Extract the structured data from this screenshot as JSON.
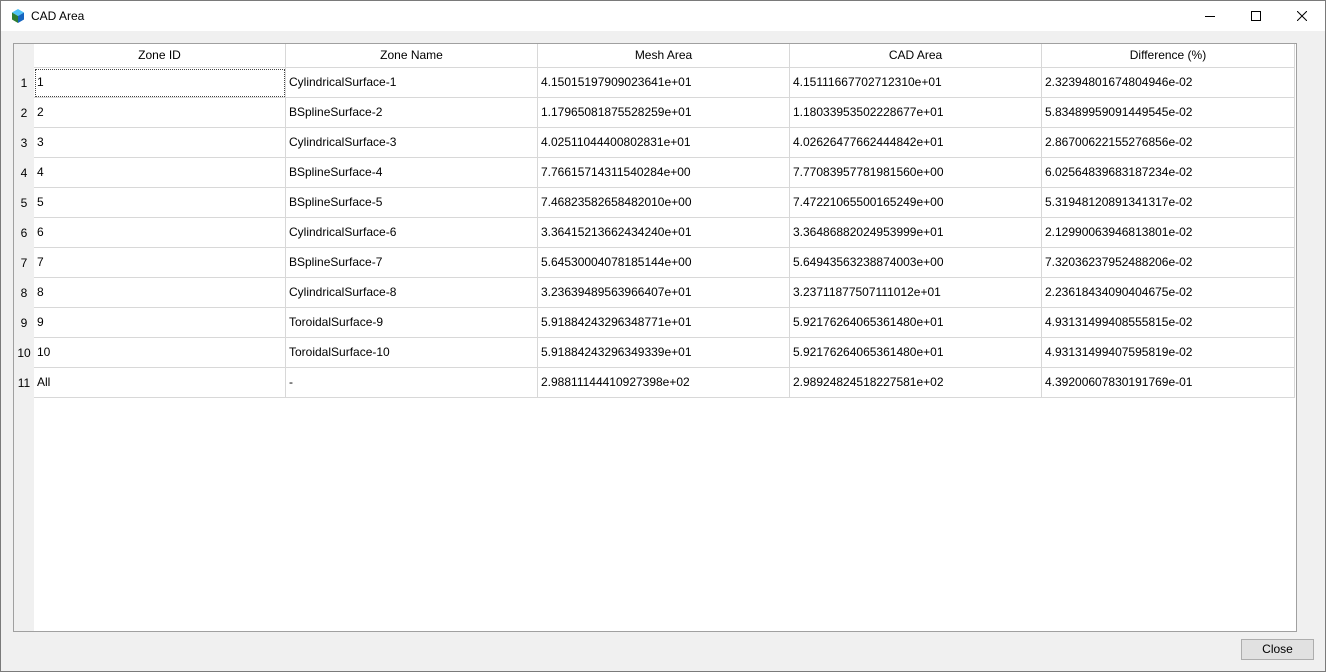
{
  "window": {
    "title": "CAD Area",
    "app_icon": "cube-logo-icon",
    "controls": [
      "minimize-icon",
      "maximize-icon",
      "close-icon"
    ]
  },
  "table": {
    "columns": [
      "Zone ID",
      "Zone Name",
      "Mesh Area",
      "CAD Area",
      "Difference (%)"
    ],
    "rows": [
      {
        "num": "1",
        "cells": [
          "1",
          "CylindricalSurface-1",
          "4.15015197909023641e+01",
          "4.15111667702712310e+01",
          "2.32394801674804946e-02"
        ]
      },
      {
        "num": "2",
        "cells": [
          "2",
          "BSplineSurface-2",
          "1.17965081875528259e+01",
          "1.18033953502228677e+01",
          "5.83489959091449545e-02"
        ]
      },
      {
        "num": "3",
        "cells": [
          "3",
          "CylindricalSurface-3",
          "4.02511044400802831e+01",
          "4.02626477662444842e+01",
          "2.86700622155276856e-02"
        ]
      },
      {
        "num": "4",
        "cells": [
          "4",
          "BSplineSurface-4",
          "7.76615714311540284e+00",
          "7.77083957781981560e+00",
          "6.02564839683187234e-02"
        ]
      },
      {
        "num": "5",
        "cells": [
          "5",
          "BSplineSurface-5",
          "7.46823582658482010e+00",
          "7.47221065500165249e+00",
          "5.31948120891341317e-02"
        ]
      },
      {
        "num": "6",
        "cells": [
          "6",
          "CylindricalSurface-6",
          "3.36415213662434240e+01",
          "3.36486882024953999e+01",
          "2.12990063946813801e-02"
        ]
      },
      {
        "num": "7",
        "cells": [
          "7",
          "BSplineSurface-7",
          "5.64530004078185144e+00",
          "5.64943563238874003e+00",
          "7.32036237952488206e-02"
        ]
      },
      {
        "num": "8",
        "cells": [
          "8",
          "CylindricalSurface-8",
          "3.23639489563966407e+01",
          "3.23711877507111012e+01",
          "2.23618434090404675e-02"
        ]
      },
      {
        "num": "9",
        "cells": [
          "9",
          "ToroidalSurface-9",
          "5.91884243296348771e+01",
          "5.92176264065361480e+01",
          "4.93131499408555815e-02"
        ]
      },
      {
        "num": "10",
        "cells": [
          "10",
          "ToroidalSurface-10",
          "5.91884243296349339e+01",
          "5.92176264065361480e+01",
          "4.93131499407595819e-02"
        ]
      },
      {
        "num": "11",
        "cells": [
          "All",
          "-",
          "2.98811144410927398e+02",
          "2.98924824518227581e+02",
          "4.39200607830191769e-01"
        ]
      }
    ]
  },
  "footer": {
    "close_label": "Close"
  },
  "colors": {
    "window_bg": "#f0f0f0",
    "titlebar_bg": "#ffffff",
    "grid_line": "#d8d8d8",
    "button_bg": "#e1e1e1"
  }
}
